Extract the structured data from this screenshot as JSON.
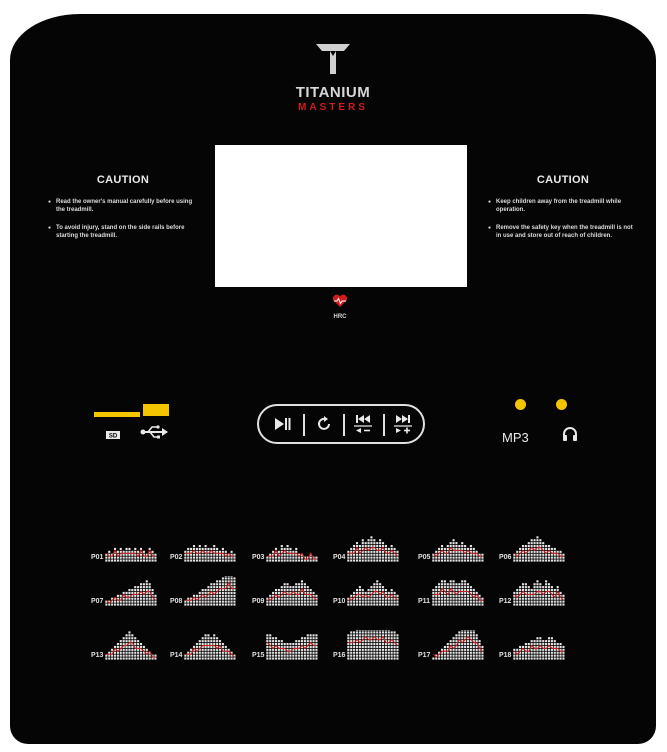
{
  "brand": {
    "name": "TITANIUM",
    "sub": "MASTERS"
  },
  "hrc": {
    "label": "HRC"
  },
  "left_caution": {
    "title": "CAUTION",
    "items": [
      "Read the owner's manual carefully before using the treadmill.",
      "To avoid injury, stand on the side rails before starting the treadmill."
    ]
  },
  "right_caution": {
    "title": "CAUTION",
    "items": [
      "Keep children away from the treadmill while operation.",
      "Remove the safety key when the treadmill is not in use and store out of reach of children."
    ]
  },
  "media": {
    "sd_label": "SD",
    "mp3_label": "MP3"
  },
  "controls": [
    {
      "name": "play-pause",
      "icon": "play-pause-icon"
    },
    {
      "name": "repeat",
      "icon": "repeat-icon"
    },
    {
      "name": "previous-volume-down",
      "icon": "previous-track-icon"
    },
    {
      "name": "next-volume-up",
      "icon": "next-track-icon"
    }
  ],
  "colors": {
    "panel": "#050505",
    "accent": "#d11c1c",
    "indicator": "#f2c500",
    "text": "#e8e8e8"
  },
  "programs": [
    {
      "label": "P01",
      "profile": [
        3,
        4,
        3,
        5,
        4,
        5,
        4,
        5,
        5,
        4,
        5,
        4,
        5,
        4,
        3,
        5,
        4,
        3
      ]
    },
    {
      "label": "P02",
      "profile": [
        4,
        5,
        5,
        6,
        5,
        6,
        5,
        6,
        5,
        5,
        6,
        5,
        4,
        5,
        4,
        3,
        4,
        3
      ]
    },
    {
      "label": "P03",
      "profile": [
        2,
        3,
        4,
        5,
        4,
        6,
        5,
        6,
        5,
        4,
        5,
        3,
        3,
        2,
        2,
        3,
        2,
        2
      ]
    },
    {
      "label": "P04",
      "profile": [
        4,
        5,
        6,
        7,
        6,
        8,
        7,
        8,
        9,
        8,
        7,
        8,
        7,
        6,
        5,
        6,
        5,
        4
      ]
    },
    {
      "label": "P05",
      "profile": [
        3,
        4,
        5,
        6,
        5,
        6,
        7,
        8,
        7,
        6,
        7,
        6,
        5,
        6,
        5,
        4,
        3,
        3
      ]
    },
    {
      "label": "P06",
      "profile": [
        3,
        4,
        5,
        6,
        6,
        7,
        8,
        8,
        9,
        8,
        7,
        6,
        6,
        5,
        5,
        4,
        4,
        3
      ]
    },
    {
      "label": "P07",
      "profile": [
        2,
        2,
        3,
        3,
        4,
        4,
        5,
        5,
        6,
        6,
        7,
        7,
        8,
        8,
        9,
        8,
        6,
        4
      ]
    },
    {
      "label": "P08",
      "profile": [
        2,
        3,
        3,
        4,
        4,
        5,
        6,
        6,
        7,
        8,
        8,
        9,
        9,
        10,
        11,
        12,
        11,
        10
      ]
    },
    {
      "label": "P09",
      "profile": [
        3,
        4,
        5,
        6,
        6,
        7,
        8,
        8,
        7,
        7,
        8,
        8,
        9,
        8,
        7,
        6,
        5,
        4
      ]
    },
    {
      "label": "P10",
      "profile": [
        3,
        4,
        5,
        6,
        7,
        6,
        5,
        6,
        7,
        8,
        9,
        8,
        7,
        6,
        5,
        6,
        5,
        4
      ]
    },
    {
      "label": "P11",
      "profile": [
        6,
        7,
        8,
        9,
        9,
        8,
        9,
        9,
        8,
        8,
        9,
        9,
        8,
        7,
        6,
        5,
        4,
        3
      ]
    },
    {
      "label": "P12",
      "profile": [
        5,
        6,
        7,
        8,
        8,
        7,
        6,
        8,
        9,
        8,
        7,
        9,
        8,
        7,
        6,
        7,
        5,
        4
      ]
    },
    {
      "label": "P13",
      "profile": [
        2,
        3,
        4,
        5,
        6,
        7,
        8,
        9,
        10,
        9,
        8,
        7,
        6,
        5,
        4,
        3,
        2,
        2
      ]
    },
    {
      "label": "P14",
      "profile": [
        2,
        3,
        4,
        5,
        6,
        7,
        8,
        9,
        9,
        8,
        9,
        8,
        7,
        6,
        5,
        4,
        3,
        2
      ]
    },
    {
      "label": "P15",
      "profile": [
        9,
        9,
        8,
        8,
        7,
        7,
        6,
        6,
        6,
        6,
        7,
        7,
        8,
        8,
        9,
        9,
        9,
        9
      ]
    },
    {
      "label": "P16",
      "profile": [
        9,
        10,
        10,
        11,
        11,
        12,
        12,
        12,
        12,
        12,
        12,
        12,
        12,
        11,
        11,
        10,
        10,
        9
      ]
    },
    {
      "label": "P17",
      "profile": [
        1,
        2,
        3,
        4,
        5,
        6,
        7,
        8,
        9,
        10,
        11,
        12,
        13,
        13,
        11,
        9,
        7,
        5
      ]
    },
    {
      "label": "P18",
      "profile": [
        4,
        4,
        5,
        5,
        6,
        6,
        7,
        7,
        8,
        8,
        7,
        7,
        8,
        8,
        7,
        6,
        6,
        5
      ]
    }
  ]
}
